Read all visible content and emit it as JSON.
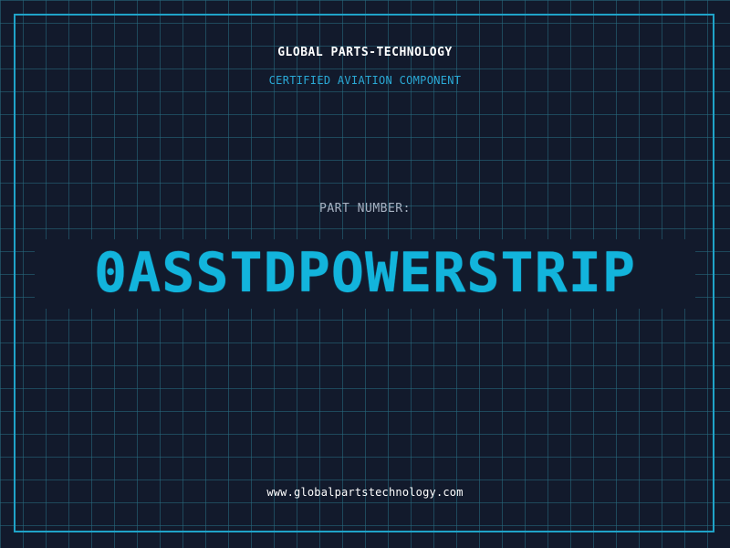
{
  "header": {
    "company": "GLOBAL PARTS-TECHNOLOGY",
    "subtitle": "CERTIFIED AVIATION COMPONENT"
  },
  "part": {
    "label": "PART NUMBER:",
    "number": "0ASSTDPOWERSTRIP"
  },
  "footer": {
    "url": "www.globalpartstechnology.com"
  },
  "colors": {
    "background": "#121a2c",
    "grid": "#286e82",
    "accent": "#12b4dc",
    "frame": "#1fa3c8"
  }
}
